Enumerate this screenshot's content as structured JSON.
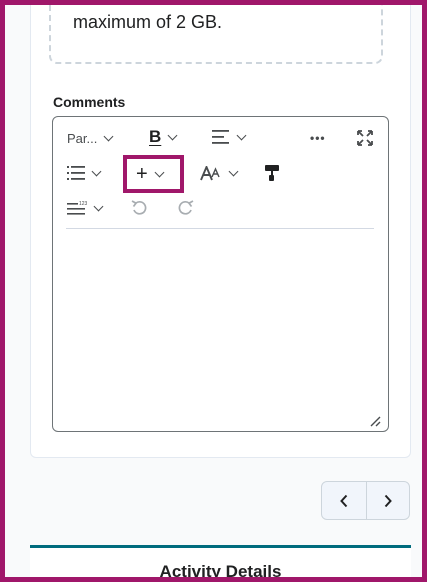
{
  "upload": {
    "hint_text": "maximum of 2 GB."
  },
  "comments": {
    "label": "Comments"
  },
  "toolbar": {
    "paragraph_label": "Par...",
    "bold_label": "B",
    "more_label": "•••",
    "insert_label": "+",
    "format_label": "AA",
    "icons": [
      "align-icon",
      "fullscreen-icon",
      "list-icon",
      "insert-icon",
      "font-size-icon",
      "format-painter-icon",
      "line-height-icon",
      "undo-icon",
      "redo-icon"
    ]
  },
  "pager": {
    "prev_icon": "chevron-left-icon",
    "next_icon": "chevron-right-icon"
  },
  "activity_details": {
    "title": "Activity Details"
  },
  "colors": {
    "frame": "#a0176a",
    "accent_bar": "#006b7d"
  }
}
